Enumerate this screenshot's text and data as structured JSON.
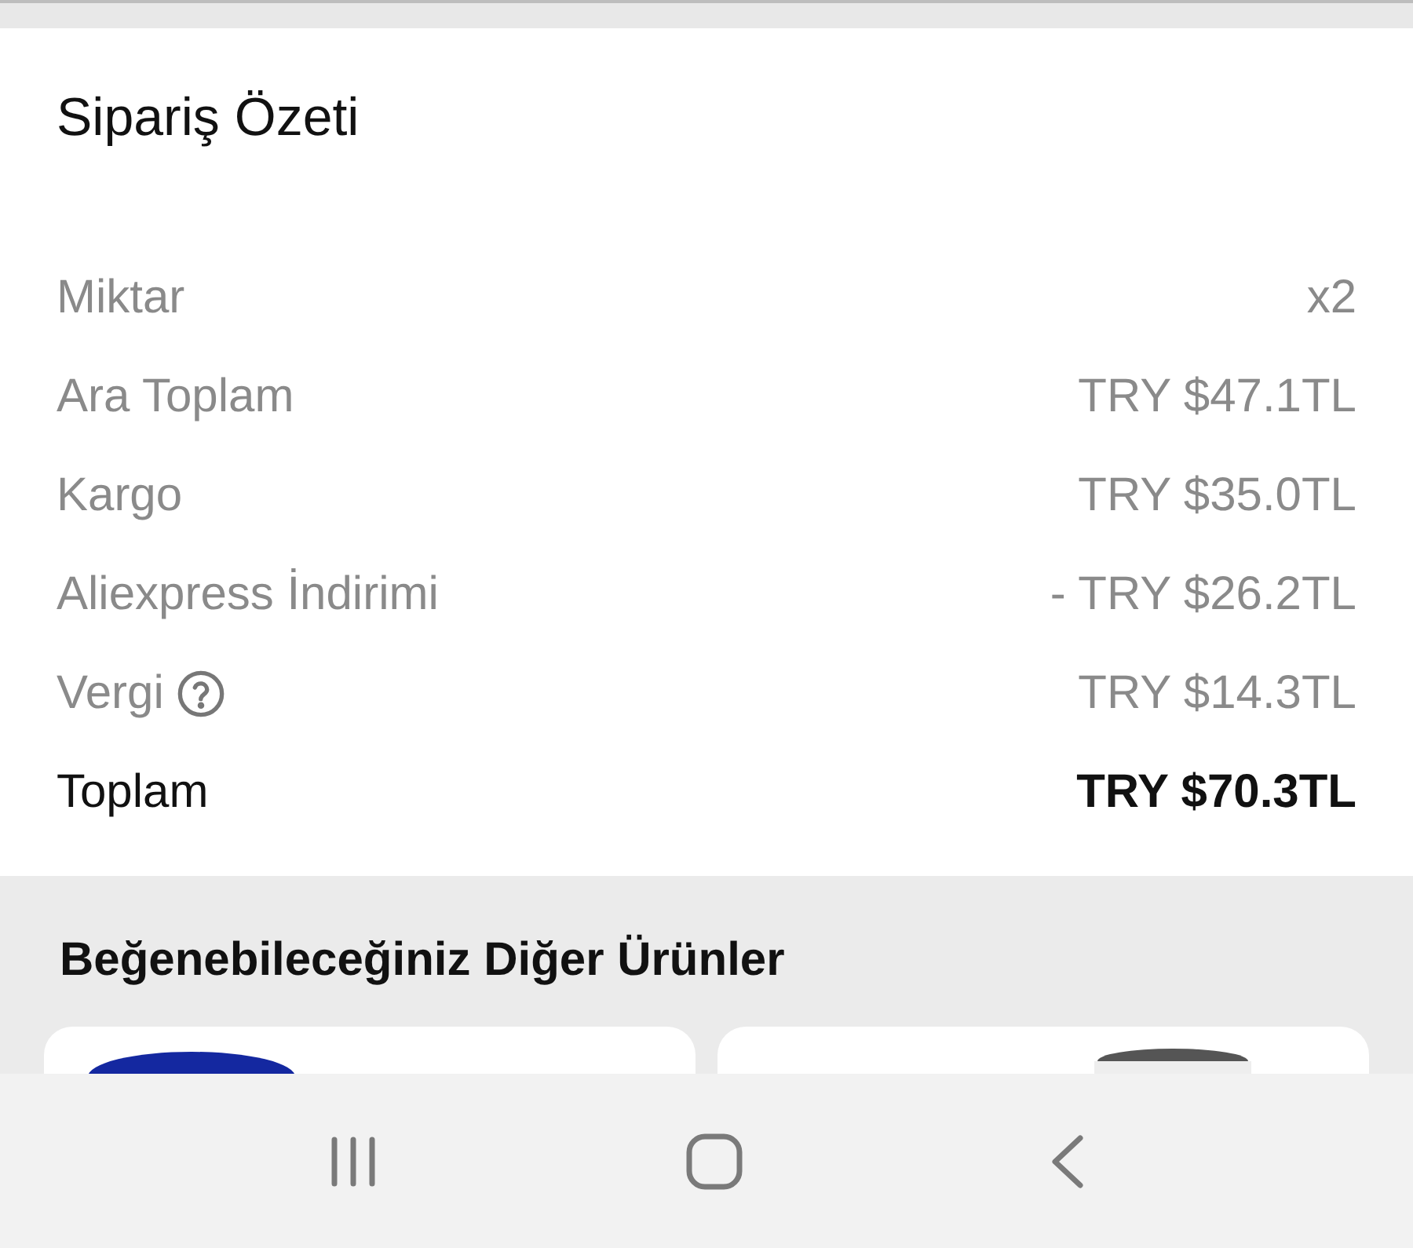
{
  "summary": {
    "title": "Sipariş Özeti",
    "rows": [
      {
        "kind": "line",
        "label": "Miktar",
        "value": "x2",
        "help": false
      },
      {
        "kind": "line",
        "label": "Ara Toplam",
        "value": "TRY $47.1TL",
        "help": false
      },
      {
        "kind": "line",
        "label": "Kargo",
        "value": "TRY $35.0TL",
        "help": false
      },
      {
        "kind": "line",
        "label": "Aliexpress İndirimi",
        "value": "- TRY $26.2TL",
        "help": false
      },
      {
        "kind": "line",
        "label": "Vergi",
        "value": "TRY $14.3TL",
        "help": true
      },
      {
        "kind": "total",
        "label": "Toplam",
        "value": "TRY $70.3TL",
        "help": false
      }
    ]
  },
  "recommendations": {
    "title": "Beğenebileceğiniz Diğer Ürünler",
    "cards": [
      {
        "kind": "logo"
      },
      {
        "kind": "picture"
      }
    ]
  }
}
